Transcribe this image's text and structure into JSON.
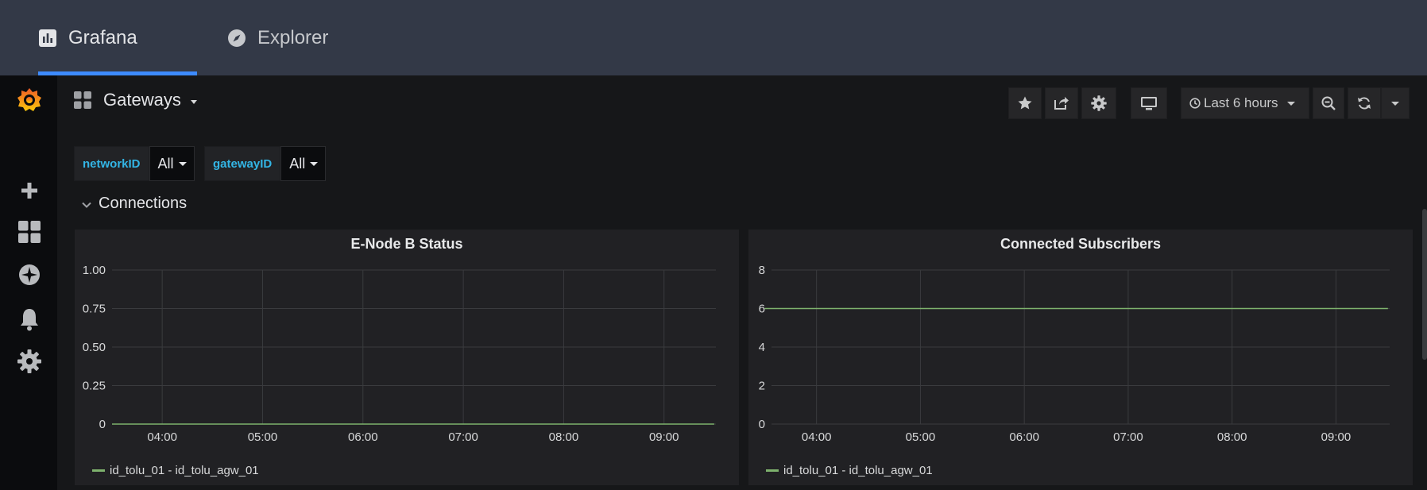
{
  "topbar": {
    "tabs": [
      {
        "label": "Grafana",
        "icon": "bar-chart-icon",
        "active": true
      },
      {
        "label": "Explorer",
        "icon": "compass-icon",
        "active": false
      }
    ]
  },
  "sidenav": {
    "items": [
      "grafana-logo-icon",
      "plus-icon",
      "dashboards-icon",
      "explore-icon",
      "bell-icon",
      "gear-icon"
    ]
  },
  "dashboard": {
    "title": "Gateways",
    "time_range": "Last 6 hours"
  },
  "variables": [
    {
      "label": "networkID",
      "value": "All"
    },
    {
      "label": "gatewayID",
      "value": "All"
    }
  ],
  "row": {
    "title": "Connections"
  },
  "colors": {
    "series": "#7eb26d",
    "accent": "#3d8bff",
    "var_label": "#33b5e5"
  },
  "chart_data": [
    {
      "type": "line",
      "title": "E-Node B Status",
      "x_ticks": [
        "04:00",
        "05:00",
        "06:00",
        "07:00",
        "08:00",
        "09:00"
      ],
      "y_ticks": [
        "1.00",
        "0.75",
        "0.50",
        "0.25",
        "0"
      ],
      "ylim": [
        0,
        1
      ],
      "series": [
        {
          "name": "id_tolu_01 - id_tolu_agw_01",
          "x": [
            "03:30",
            "09:30"
          ],
          "y": [
            0,
            0
          ]
        }
      ]
    },
    {
      "type": "line",
      "title": "Connected Subscribers",
      "x_ticks": [
        "04:00",
        "05:00",
        "06:00",
        "07:00",
        "08:00",
        "09:00"
      ],
      "y_ticks": [
        "8",
        "6",
        "4",
        "2",
        "0"
      ],
      "ylim": [
        0,
        8
      ],
      "series": [
        {
          "name": "id_tolu_01 - id_tolu_agw_01",
          "x": [
            "03:30",
            "09:30"
          ],
          "y": [
            6,
            6
          ]
        }
      ]
    }
  ]
}
